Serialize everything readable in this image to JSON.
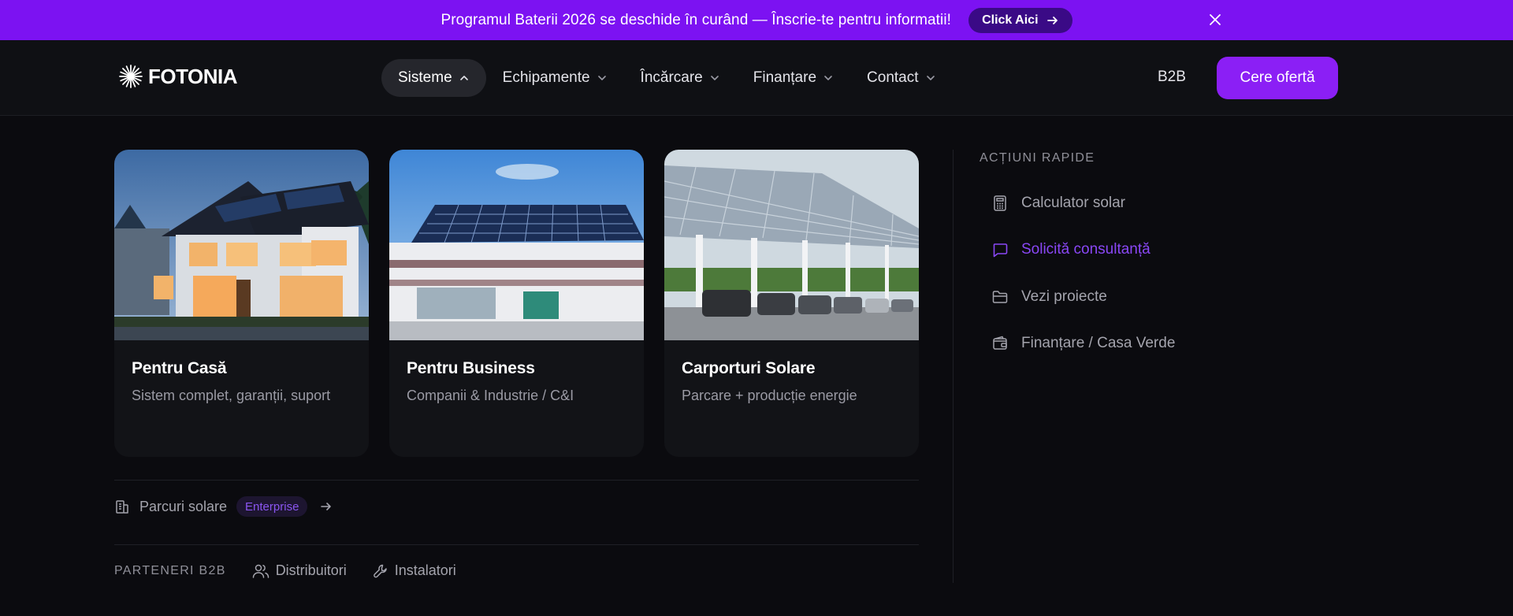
{
  "announcement": {
    "text": "Programul Baterii 2026 se deschide în curând — Înscrie-te pentru informatii!",
    "button_label": "Click Aici"
  },
  "header": {
    "logo_text": "FOTONIA",
    "nav": [
      {
        "label": "Sisteme",
        "active": true
      },
      {
        "label": "Echipamente"
      },
      {
        "label": "Încărcare"
      },
      {
        "label": "Finanțare"
      },
      {
        "label": "Contact"
      }
    ],
    "b2b_label": "B2B",
    "cta_label": "Cere ofertă"
  },
  "cards": [
    {
      "title": "Pentru Casă",
      "subtitle": "Sistem complet, garanții, suport"
    },
    {
      "title": "Pentru Business",
      "subtitle": "Companii & Industrie / C&I"
    },
    {
      "title": "Carporturi Solare",
      "subtitle": "Parcare + producție energie"
    }
  ],
  "parcuri": {
    "label": "Parcuri solare",
    "badge": "Enterprise"
  },
  "partners": {
    "title": "PARTENERI B2B",
    "links": [
      "Distribuitori",
      "Instalatori"
    ]
  },
  "quick_actions": {
    "title": "ACȚIUNI RAPIDE",
    "items": [
      {
        "label": "Calculator solar",
        "icon": "calculator-icon"
      },
      {
        "label": "Solicită consultanță",
        "icon": "chat-icon",
        "highlighted": true
      },
      {
        "label": "Vezi proiecte",
        "icon": "folder-icon"
      },
      {
        "label": "Finanțare / Casa Verde",
        "icon": "wallet-icon"
      }
    ]
  },
  "colors": {
    "accent": "#8b1ff5",
    "banner": "#7c12f2",
    "background": "#0b0b0f",
    "highlight_text": "#8a47f6"
  }
}
